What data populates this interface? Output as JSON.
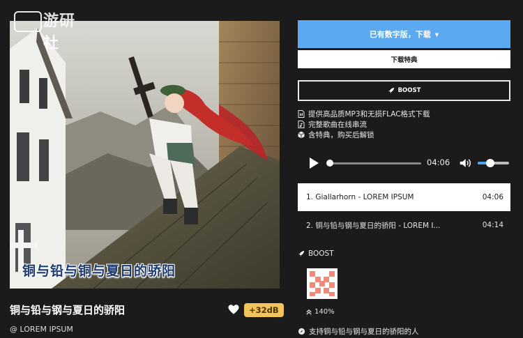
{
  "watermark": {
    "text": "游研社"
  },
  "cover": {
    "caption": "铜与铅与铜与夏日的骄阳"
  },
  "album": {
    "title": "铜与铅与钢与夏日的骄阳",
    "boost_badge": "+32dB",
    "artist": "@ LOREM IPSUM"
  },
  "actions": {
    "primary_label": "已有数字版，下载",
    "secondary_label": "下载特典",
    "boost_label": "BOOST"
  },
  "features": [
    {
      "icon": "file-audio-icon",
      "text": "提供高品质MP3和无损FLAC格式下载"
    },
    {
      "icon": "file-music-icon",
      "text": "完整歌曲在线串流"
    },
    {
      "icon": "box-icon",
      "text": "含特典，购买后解锁"
    }
  ],
  "player": {
    "time": "04:06",
    "progress": 0.0,
    "volume": 0.4
  },
  "tracks": [
    {
      "title": "1. Giallarhorn - LOREM IPSUM",
      "duration": "04:06",
      "active": true
    },
    {
      "title": "2. 铜与铅与钢与夏日的骄阳 - LOREM I...",
      "duration": "04:14",
      "active": false
    }
  ],
  "supporters": {
    "heading": "BOOST",
    "percent": "140%",
    "support_text": "支持铜与铅与钢与夏日的骄阳的人"
  },
  "colors": {
    "accent_blue": "#5aa9f1",
    "badge_yellow": "#f3c35c",
    "background": "#1b1b1b"
  }
}
